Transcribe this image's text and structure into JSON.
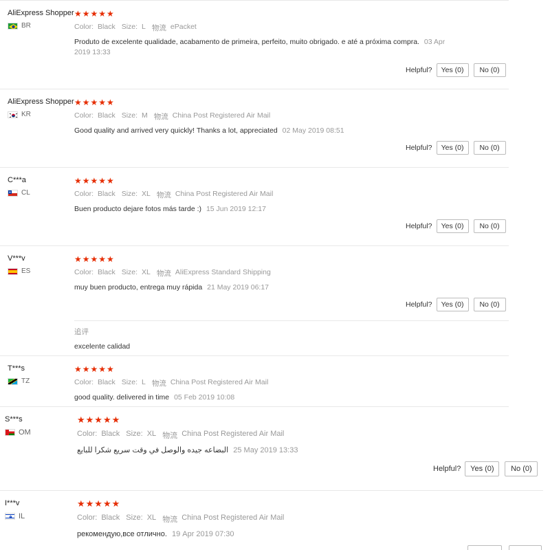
{
  "reviews": [
    {
      "user": "AliExpress Shopper",
      "country": "BR",
      "stars": "★★★★★",
      "color_lbl": "Color:",
      "color": "Black",
      "size_lbl": "Size:",
      "size": "L",
      "ship_lbl": "物流",
      "ship": "ePacket",
      "text": "Produto de excelente qualidade, acabamento de primeira, perfeito, muito obrigado. e até a próxima compra.",
      "date": "03 Apr 2019 13:33",
      "helpful": "Helpful?",
      "yes": "Yes (0)",
      "no": "No (0)"
    },
    {
      "user": "AliExpress Shopper",
      "country": "KR",
      "stars": "★★★★★",
      "color_lbl": "Color:",
      "color": "Black",
      "size_lbl": "Size:",
      "size": "M",
      "ship_lbl": "物流",
      "ship": "China Post Registered Air Mail",
      "text": "Good quality and arrived very quickly! Thanks a lot, appreciated",
      "date": "02 May 2019 08:51",
      "helpful": "Helpful?",
      "yes": "Yes (0)",
      "no": "No (0)"
    },
    {
      "user": "C***a",
      "country": "CL",
      "stars": "★★★★★",
      "color_lbl": "Color:",
      "color": "Black",
      "size_lbl": "Size:",
      "size": "XL",
      "ship_lbl": "物流",
      "ship": "China Post Registered Air Mail",
      "text": "Buen producto dejare fotos más tarde :)",
      "date": "15 Jun 2019 12:17",
      "helpful": "Helpful?",
      "yes": "Yes (0)",
      "no": "No (0)"
    },
    {
      "user": "V***v",
      "country": "ES",
      "stars": "★★★★★",
      "color_lbl": "Color:",
      "color": "Black",
      "size_lbl": "Size:",
      "size": "XL",
      "ship_lbl": "物流",
      "ship": "AliExpress Standard Shipping",
      "text": "muy buen producto, entrega muy rápida",
      "date": "21 May 2019 06:17",
      "helpful": "Helpful?",
      "yes": "Yes (0)",
      "no": "No (0)",
      "append_label": "追评",
      "append_text": "excelente calidad"
    },
    {
      "user": "T***s",
      "country": "TZ",
      "stars": "★★★★★",
      "color_lbl": "Color:",
      "color": "Black",
      "size_lbl": "Size:",
      "size": "L",
      "ship_lbl": "物流",
      "ship": "China Post Registered Air Mail",
      "text": "good quality. delivered in time",
      "date": "05 Feb 2019 10:08"
    },
    {
      "user": "S***s",
      "country": "OM",
      "stars": "★★★★★",
      "color_lbl": "Color:",
      "color": "Black",
      "size_lbl": "Size:",
      "size": "XL",
      "ship_lbl": "物流",
      "ship": "China Post Registered Air Mail",
      "text": "البضاعه جيده والوصل في وقت سريع شكرا للبايع",
      "date": "25 May 2019 13:33",
      "helpful": "Helpful?",
      "yes": "Yes (0)",
      "no": "No (0)"
    },
    {
      "user": "I***v",
      "country": "IL",
      "stars": "★★★★★",
      "color_lbl": "Color:",
      "color": "Black",
      "size_lbl": "Size:",
      "size": "XL",
      "ship_lbl": "物流",
      "ship": "China Post Registered Air Mail",
      "text": "рекомендую,все отлично.",
      "date": "19 Apr 2019 07:30"
    }
  ],
  "colors": {
    "star": "#e62e04",
    "muted": "#999999",
    "border": "#e8e8e8"
  }
}
